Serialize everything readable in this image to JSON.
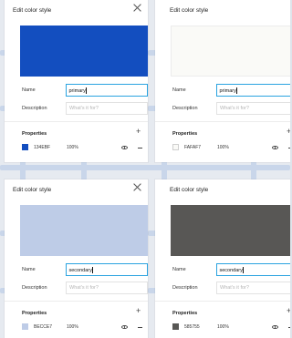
{
  "panels": [
    {
      "title": "Edit color style",
      "color": "#134EBF",
      "name_label": "Name",
      "name_value": "primary",
      "desc_label": "Description",
      "desc_placeholder": "What's it for?",
      "props_label": "Properties",
      "hex": "134EBF",
      "opacity": "100%"
    },
    {
      "title": "Edit color style",
      "color": "#FAFAF7",
      "name_label": "Name",
      "name_value": "primary",
      "desc_label": "Description",
      "desc_placeholder": "What's it for?",
      "props_label": "Properties",
      "hex": "FAFAF7",
      "opacity": "100%"
    },
    {
      "title": "Edit color style",
      "color": "#BECCE7",
      "name_label": "Name",
      "name_value": "secondary",
      "desc_label": "Description",
      "desc_placeholder": "What's it for?",
      "props_label": "Properties",
      "hex": "BECCE7",
      "opacity": "100%"
    },
    {
      "title": "Edit color style",
      "color": "#585755",
      "name_label": "Name",
      "name_value": "secondary",
      "desc_label": "Description",
      "desc_placeholder": "What's it for?",
      "props_label": "Properties",
      "hex": "585755",
      "opacity": "100%"
    }
  ],
  "icons": {
    "close": "close-icon",
    "add": "plus-icon",
    "visibility": "eye-icon",
    "remove": "minus-icon"
  },
  "colors": {
    "focus_border": "#2aa3e0",
    "connector": "#c9d6ea"
  }
}
